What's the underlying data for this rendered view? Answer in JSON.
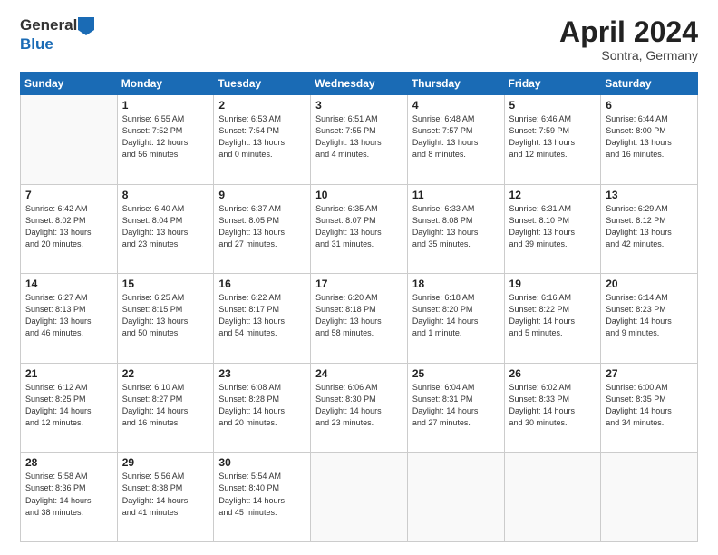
{
  "header": {
    "logo_general": "General",
    "logo_blue": "Blue",
    "month_year": "April 2024",
    "location": "Sontra, Germany"
  },
  "days_of_week": [
    "Sunday",
    "Monday",
    "Tuesday",
    "Wednesday",
    "Thursday",
    "Friday",
    "Saturday"
  ],
  "weeks": [
    [
      {
        "day": "",
        "info": ""
      },
      {
        "day": "1",
        "info": "Sunrise: 6:55 AM\nSunset: 7:52 PM\nDaylight: 12 hours\nand 56 minutes."
      },
      {
        "day": "2",
        "info": "Sunrise: 6:53 AM\nSunset: 7:54 PM\nDaylight: 13 hours\nand 0 minutes."
      },
      {
        "day": "3",
        "info": "Sunrise: 6:51 AM\nSunset: 7:55 PM\nDaylight: 13 hours\nand 4 minutes."
      },
      {
        "day": "4",
        "info": "Sunrise: 6:48 AM\nSunset: 7:57 PM\nDaylight: 13 hours\nand 8 minutes."
      },
      {
        "day": "5",
        "info": "Sunrise: 6:46 AM\nSunset: 7:59 PM\nDaylight: 13 hours\nand 12 minutes."
      },
      {
        "day": "6",
        "info": "Sunrise: 6:44 AM\nSunset: 8:00 PM\nDaylight: 13 hours\nand 16 minutes."
      }
    ],
    [
      {
        "day": "7",
        "info": "Sunrise: 6:42 AM\nSunset: 8:02 PM\nDaylight: 13 hours\nand 20 minutes."
      },
      {
        "day": "8",
        "info": "Sunrise: 6:40 AM\nSunset: 8:04 PM\nDaylight: 13 hours\nand 23 minutes."
      },
      {
        "day": "9",
        "info": "Sunrise: 6:37 AM\nSunset: 8:05 PM\nDaylight: 13 hours\nand 27 minutes."
      },
      {
        "day": "10",
        "info": "Sunrise: 6:35 AM\nSunset: 8:07 PM\nDaylight: 13 hours\nand 31 minutes."
      },
      {
        "day": "11",
        "info": "Sunrise: 6:33 AM\nSunset: 8:08 PM\nDaylight: 13 hours\nand 35 minutes."
      },
      {
        "day": "12",
        "info": "Sunrise: 6:31 AM\nSunset: 8:10 PM\nDaylight: 13 hours\nand 39 minutes."
      },
      {
        "day": "13",
        "info": "Sunrise: 6:29 AM\nSunset: 8:12 PM\nDaylight: 13 hours\nand 42 minutes."
      }
    ],
    [
      {
        "day": "14",
        "info": "Sunrise: 6:27 AM\nSunset: 8:13 PM\nDaylight: 13 hours\nand 46 minutes."
      },
      {
        "day": "15",
        "info": "Sunrise: 6:25 AM\nSunset: 8:15 PM\nDaylight: 13 hours\nand 50 minutes."
      },
      {
        "day": "16",
        "info": "Sunrise: 6:22 AM\nSunset: 8:17 PM\nDaylight: 13 hours\nand 54 minutes."
      },
      {
        "day": "17",
        "info": "Sunrise: 6:20 AM\nSunset: 8:18 PM\nDaylight: 13 hours\nand 58 minutes."
      },
      {
        "day": "18",
        "info": "Sunrise: 6:18 AM\nSunset: 8:20 PM\nDaylight: 14 hours\nand 1 minute."
      },
      {
        "day": "19",
        "info": "Sunrise: 6:16 AM\nSunset: 8:22 PM\nDaylight: 14 hours\nand 5 minutes."
      },
      {
        "day": "20",
        "info": "Sunrise: 6:14 AM\nSunset: 8:23 PM\nDaylight: 14 hours\nand 9 minutes."
      }
    ],
    [
      {
        "day": "21",
        "info": "Sunrise: 6:12 AM\nSunset: 8:25 PM\nDaylight: 14 hours\nand 12 minutes."
      },
      {
        "day": "22",
        "info": "Sunrise: 6:10 AM\nSunset: 8:27 PM\nDaylight: 14 hours\nand 16 minutes."
      },
      {
        "day": "23",
        "info": "Sunrise: 6:08 AM\nSunset: 8:28 PM\nDaylight: 14 hours\nand 20 minutes."
      },
      {
        "day": "24",
        "info": "Sunrise: 6:06 AM\nSunset: 8:30 PM\nDaylight: 14 hours\nand 23 minutes."
      },
      {
        "day": "25",
        "info": "Sunrise: 6:04 AM\nSunset: 8:31 PM\nDaylight: 14 hours\nand 27 minutes."
      },
      {
        "day": "26",
        "info": "Sunrise: 6:02 AM\nSunset: 8:33 PM\nDaylight: 14 hours\nand 30 minutes."
      },
      {
        "day": "27",
        "info": "Sunrise: 6:00 AM\nSunset: 8:35 PM\nDaylight: 14 hours\nand 34 minutes."
      }
    ],
    [
      {
        "day": "28",
        "info": "Sunrise: 5:58 AM\nSunset: 8:36 PM\nDaylight: 14 hours\nand 38 minutes."
      },
      {
        "day": "29",
        "info": "Sunrise: 5:56 AM\nSunset: 8:38 PM\nDaylight: 14 hours\nand 41 minutes."
      },
      {
        "day": "30",
        "info": "Sunrise: 5:54 AM\nSunset: 8:40 PM\nDaylight: 14 hours\nand 45 minutes."
      },
      {
        "day": "",
        "info": ""
      },
      {
        "day": "",
        "info": ""
      },
      {
        "day": "",
        "info": ""
      },
      {
        "day": "",
        "info": ""
      }
    ]
  ]
}
